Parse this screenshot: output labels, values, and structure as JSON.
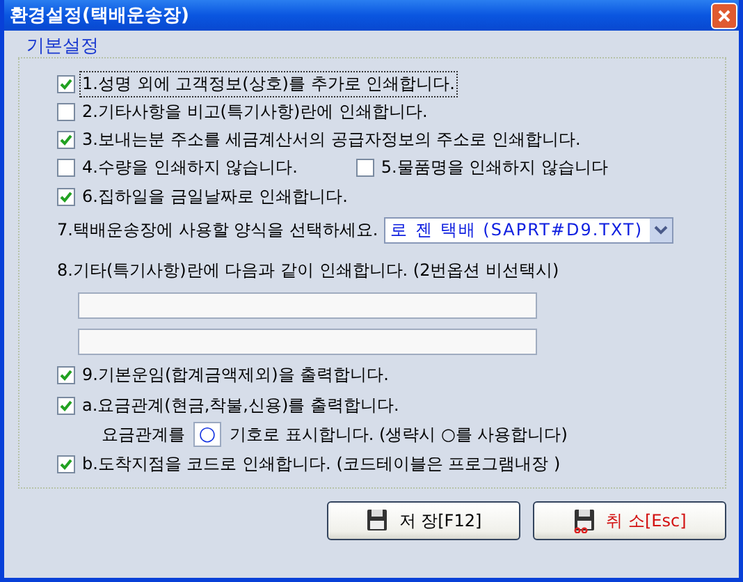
{
  "window": {
    "title": "환경설정(택배운송장)"
  },
  "group": {
    "title": "기본설정"
  },
  "rows": [
    {
      "kind": "checks",
      "items": [
        {
          "label": "1.성명 외에 고객정보(상호)를 추가로 인쇄합니다.",
          "checked": true,
          "focused": true
        }
      ]
    },
    {
      "kind": "checks",
      "items": [
        {
          "label": "2.기타사항을 비고(특기사항)란에 인쇄합니다.",
          "checked": false,
          "focused": false
        }
      ]
    },
    {
      "kind": "checks",
      "items": [
        {
          "label": "3.보내는분 주소를 세금계산서의 공급자정보의 주소로 인쇄합니다.",
          "checked": true,
          "focused": false
        }
      ]
    },
    {
      "kind": "checks",
      "items": [
        {
          "label": "4.수량을 인쇄하지 않습니다.",
          "checked": false,
          "focused": false
        },
        {
          "label": "5.물품명을 인쇄하지 않습니다",
          "checked": false,
          "focused": false
        }
      ]
    },
    {
      "kind": "checks",
      "items": [
        {
          "label": "6.집하일을 금일날짜로 인쇄합니다.",
          "checked": true,
          "focused": false
        }
      ]
    },
    {
      "kind": "select",
      "label": "7.택배운송장에 사용할 양식을 선택하세요.",
      "value": "로 젠 택배 (SAPRT#D9.TXT)"
    },
    {
      "kind": "label",
      "label": "8.기타(특기사항)란에 다음과 같이 인쇄합니다. (2번옵션 비선택시)"
    },
    {
      "kind": "field"
    },
    {
      "kind": "field"
    },
    {
      "kind": "checks",
      "items": [
        {
          "label": "9.기본운임(합계금액제외)을 출력합니다.",
          "checked": true,
          "focused": false
        }
      ]
    },
    {
      "kind": "checks",
      "items": [
        {
          "label": "a.요금관계(현금,착불,신용)를 출력합니다.",
          "checked": true,
          "focused": false
        }
      ]
    },
    {
      "kind": "symbol",
      "label": "요금관계를",
      "value": "○",
      "note": "기호로 표시합니다. (생략시 ○를 사용합니다)"
    },
    {
      "kind": "checks",
      "items": [
        {
          "label": "b.도착지점을 코드로 인쇄합니다. (코드테이블은 프로그램내장 )",
          "checked": true,
          "focused": false
        }
      ]
    }
  ],
  "buttons": [
    {
      "kind": "save",
      "label": "저 장[F12]"
    },
    {
      "kind": "cancel",
      "label": "취 소[Esc]"
    }
  ]
}
